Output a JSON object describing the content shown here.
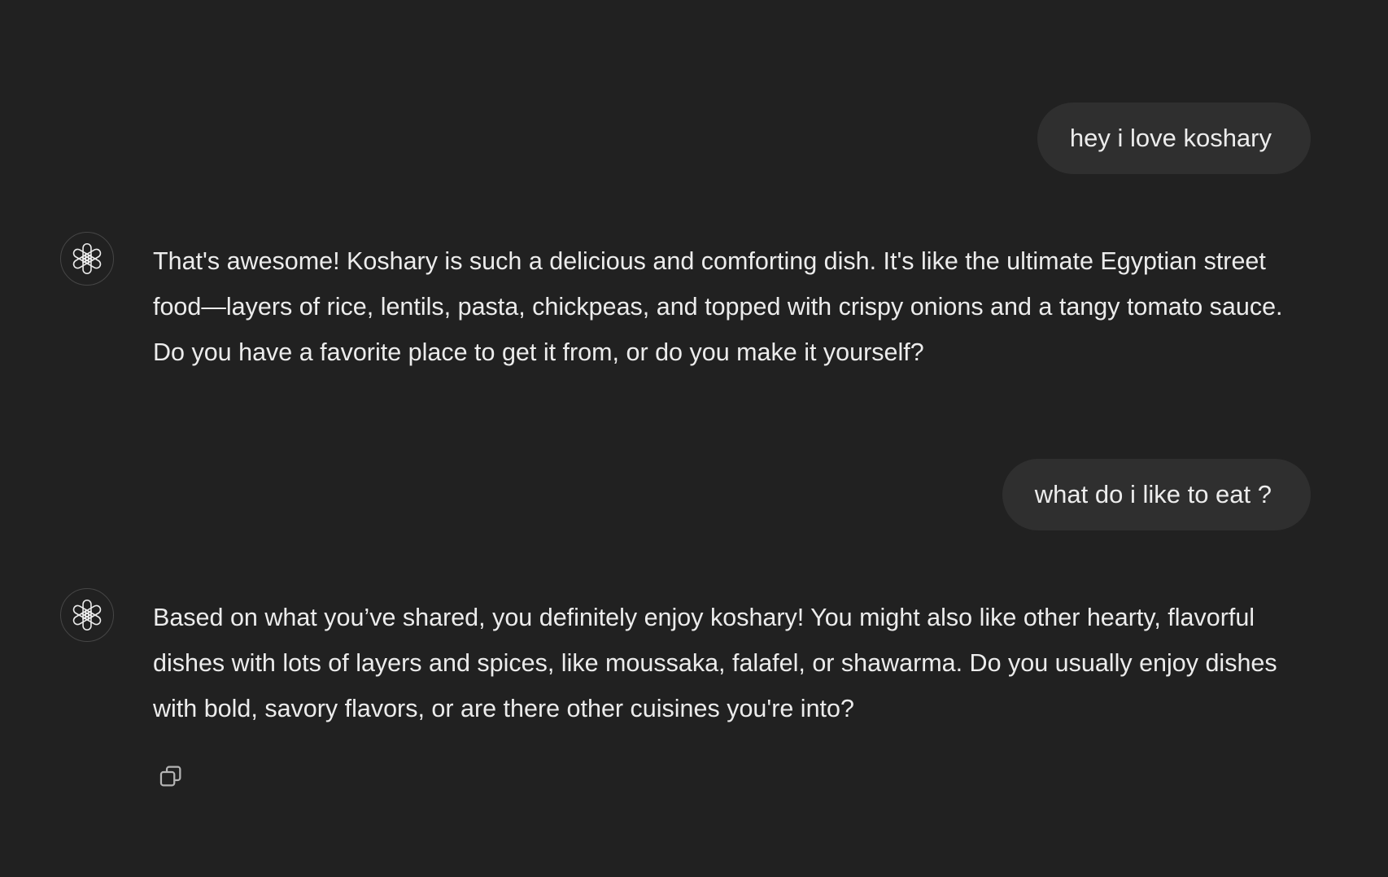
{
  "conversation": {
    "messages": [
      {
        "role": "user",
        "text": "hey i love koshary"
      },
      {
        "role": "assistant",
        "text": "That's awesome! Koshary is such a delicious and comforting dish. It's like the ultimate Egyptian street food—layers of rice, lentils, pasta, chickpeas, and topped with crispy onions and a tangy tomato sauce. Do you have a favorite place to get it from, or do you make it yourself?"
      },
      {
        "role": "user",
        "text": "what do i like to eat ?"
      },
      {
        "role": "assistant",
        "text": "Based on what you’ve shared, you definitely enjoy koshary! You might also like other hearty, flavorful dishes with lots of layers and spices, like moussaka, falafel, or shawarma. Do you usually enjoy dishes with bold, savory flavors, or are there other cuisines you're into?"
      }
    ]
  },
  "icons": {
    "assistant_avatar": "openai-logo-icon",
    "copy": "copy-icon"
  },
  "colors": {
    "background": "#212121",
    "user_bubble": "#2f2f2f",
    "text": "#ececec",
    "avatar_border": "#464646",
    "icon": "#b4b4b4"
  }
}
